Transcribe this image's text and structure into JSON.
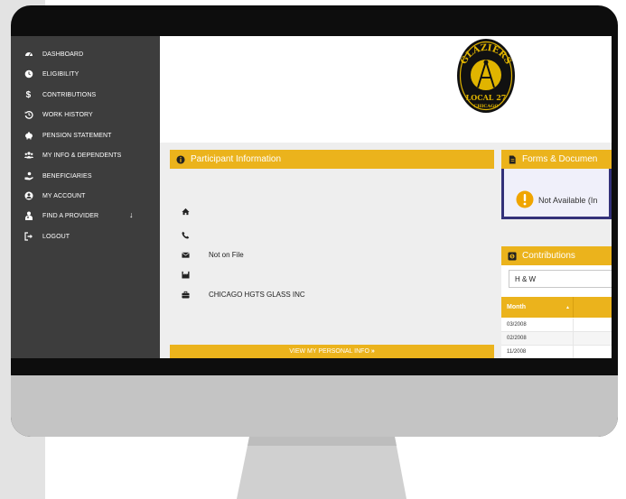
{
  "sidebar": {
    "items": [
      {
        "label": "DASHBOARD",
        "icon": "dashboard-icon"
      },
      {
        "label": "ELIGIBILITY",
        "icon": "clock-icon"
      },
      {
        "label": "CONTRIBUTIONS",
        "icon": "dollar-icon"
      },
      {
        "label": "WORK HISTORY",
        "icon": "history-icon"
      },
      {
        "label": "PENSION STATEMENT",
        "icon": "piggy-bank-icon"
      },
      {
        "label": "MY INFO & DEPENDENTS",
        "icon": "users-icon"
      },
      {
        "label": "BENEFICIARIES",
        "icon": "hand-holding-icon"
      },
      {
        "label": "MY ACCOUNT",
        "icon": "user-circle-icon"
      },
      {
        "label": "FIND A PROVIDER",
        "icon": "user-md-icon",
        "has_dropdown": true
      },
      {
        "label": "LOGOUT",
        "icon": "logout-icon"
      }
    ]
  },
  "logo": {
    "top_text": "GLAZIERS",
    "bottom_text": "LOCAL 27",
    "city": "CHICAGO"
  },
  "participant": {
    "title": "Participant Information",
    "email": "Not on File",
    "employer": "CHICAGO HGTS GLASS INC",
    "view_button": "VIEW MY PERSONAL INFO",
    "view_button_arrow": "»"
  },
  "forms": {
    "title": "Forms & Documen",
    "status": "Not Available (In"
  },
  "contributions": {
    "title": "Contributions",
    "selected_fund": "H & W",
    "month_header": "Month",
    "rows": [
      "03/2008",
      "02/2008",
      "11/2008"
    ]
  },
  "colors": {
    "accent": "#ebb31c",
    "sidebar": "#3d3d3d",
    "alert_border": "#33317a",
    "alert_icon": "#f0a500"
  }
}
